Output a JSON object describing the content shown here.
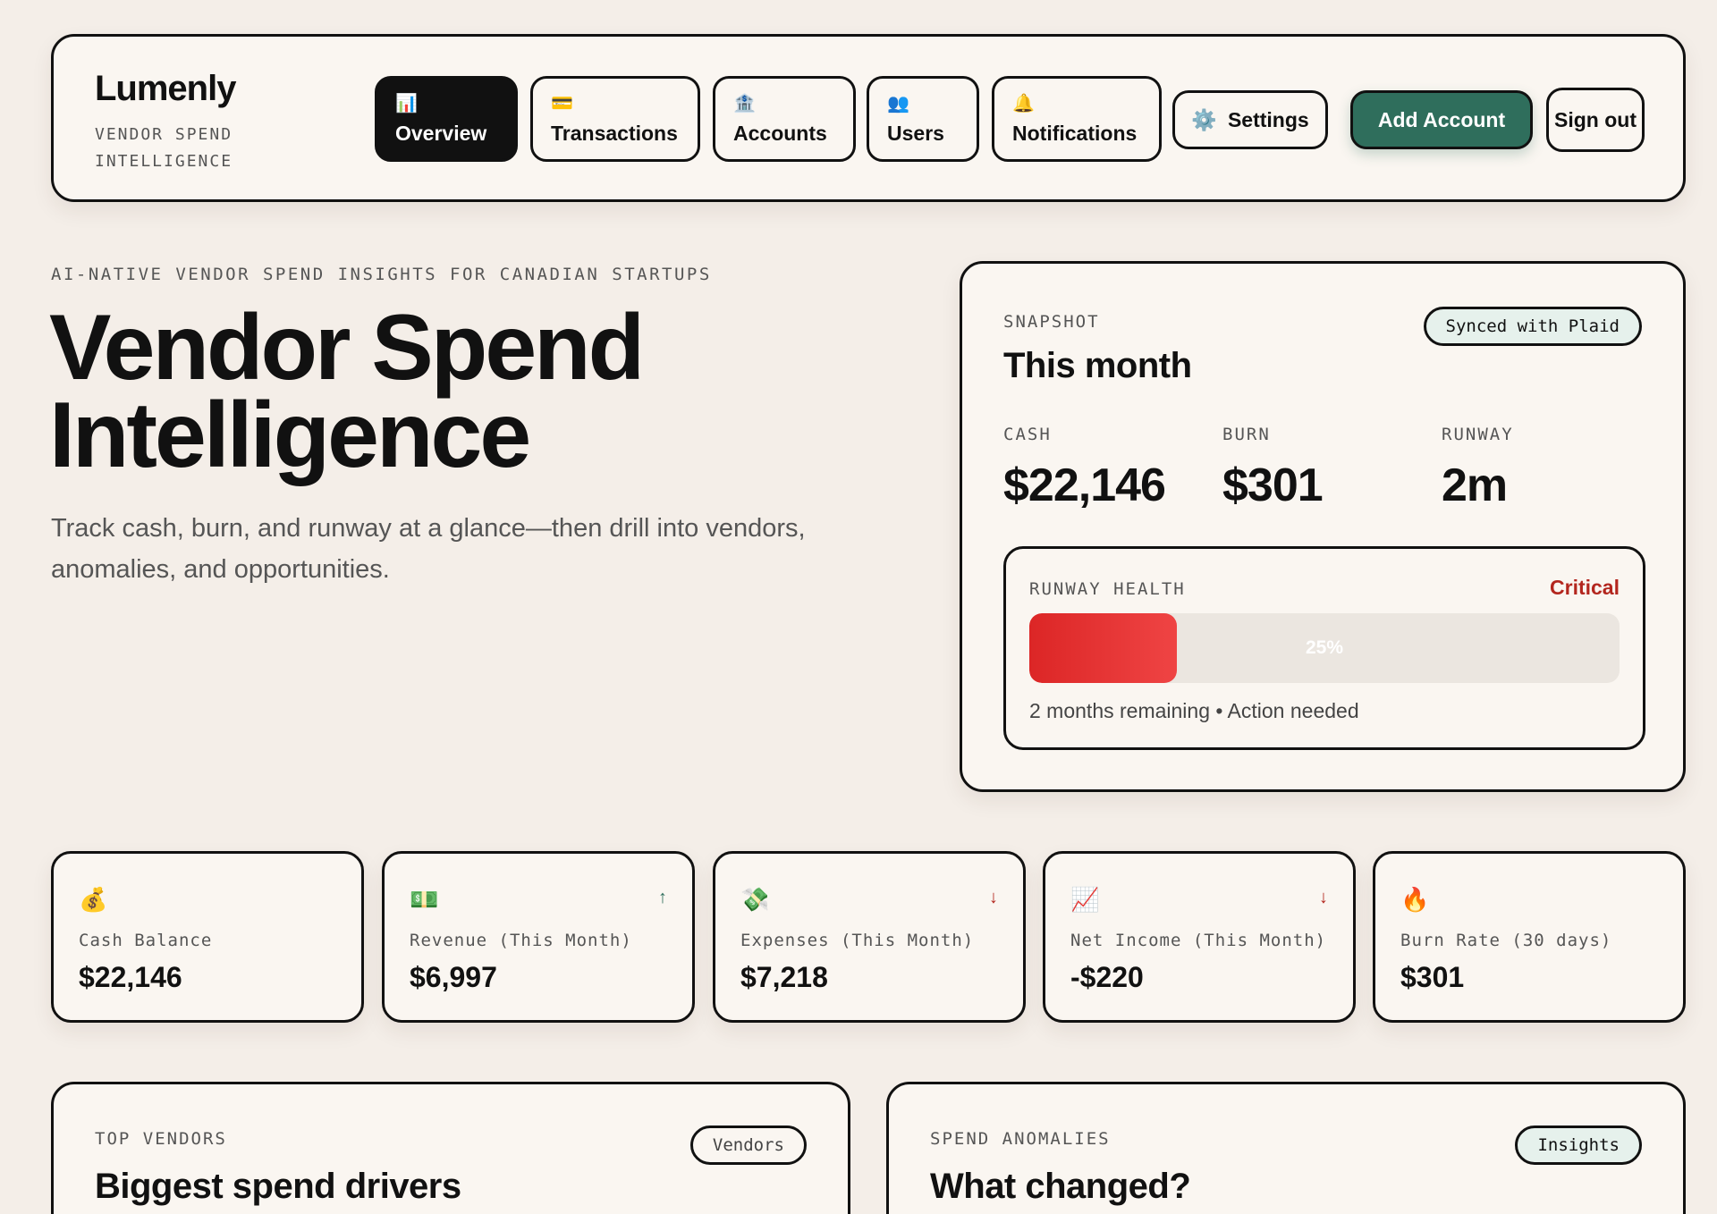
{
  "brand": {
    "name": "Lumenly",
    "tagline": "VENDOR SPEND INTELLIGENCE"
  },
  "nav": [
    {
      "icon": "📊",
      "label": "Overview",
      "active": true
    },
    {
      "icon": "💳",
      "label": "Transactions"
    },
    {
      "icon": "🏦",
      "label": "Accounts"
    },
    {
      "icon": "👥",
      "label": "Users"
    },
    {
      "icon": "🔔",
      "label": "Notifications"
    }
  ],
  "actions": {
    "settings_icon": "⚙️",
    "settings": "Settings",
    "add_account": "Add Account",
    "sign_out": "Sign out"
  },
  "hero": {
    "eyebrow": "AI-NATIVE VENDOR SPEND INSIGHTS FOR CANADIAN STARTUPS",
    "title_line1": "Vendor Spend",
    "title_line2": "Intelligence",
    "subtitle": "Track cash, burn, and runway at a glance—then drill into vendors, anomalies, and opportunities."
  },
  "snapshot": {
    "eyebrow": "SNAPSHOT",
    "title": "This month",
    "badge": "Synced with Plaid",
    "metrics": [
      {
        "label": "CASH",
        "value": "$22,146"
      },
      {
        "label": "BURN",
        "value": "$301"
      },
      {
        "label": "RUNWAY",
        "value": "2m"
      }
    ],
    "health": {
      "label": "RUNWAY HEALTH",
      "status": "Critical",
      "percent": 25,
      "percent_label": "25%",
      "note": "2 months remaining • Action needed",
      "color": "#dc2626"
    }
  },
  "stats": [
    {
      "icon": "💰",
      "label": "Cash Balance",
      "value": "$22,146",
      "trend": ""
    },
    {
      "icon": "💵",
      "label": "Revenue (This Month)",
      "value": "$6,997",
      "trend": "↑"
    },
    {
      "icon": "💸",
      "label": "Expenses (This Month)",
      "value": "$7,218",
      "trend": "↓"
    },
    {
      "icon": "📈",
      "label": "Net Income (This Month)",
      "value": "-$220",
      "trend": "↓"
    },
    {
      "icon": "🔥",
      "label": "Burn Rate (30 days)",
      "value": "$301",
      "trend": ""
    }
  ],
  "panels": {
    "vendors": {
      "eyebrow": "TOP VENDORS",
      "title": "Biggest spend drivers",
      "badge": "Vendors"
    },
    "anomalies": {
      "eyebrow": "SPEND ANOMALIES",
      "title": "What changed?",
      "badge": "Insights"
    }
  },
  "colors": {
    "accent": "#2f6e5c",
    "critical": "#b3261e",
    "background": "#f4eee8",
    "card": "#faf6f1"
  }
}
